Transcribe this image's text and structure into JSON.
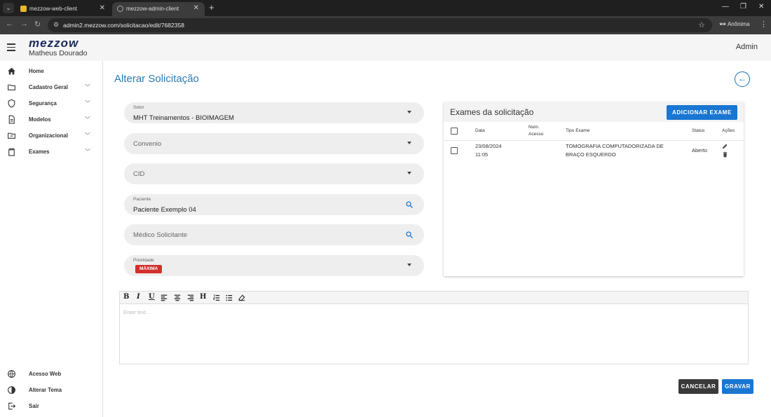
{
  "browser": {
    "tabs": [
      {
        "title": "mezzow-web-client"
      },
      {
        "title": "mezzow-admin-client"
      }
    ],
    "url": "admin2.mezzow.com/solicitacao/edit/7682358",
    "profile_label": "Anônima"
  },
  "header": {
    "logo": "mezzow",
    "user_name": "Matheus Dourado",
    "role": "Admin"
  },
  "sidebar": {
    "items": [
      {
        "label": "Home",
        "icon": "home-icon"
      },
      {
        "label": "Cadastro Geral",
        "icon": "folder-icon"
      },
      {
        "label": "Segurança",
        "icon": "shield-icon"
      },
      {
        "label": "Modelos",
        "icon": "document-icon"
      },
      {
        "label": "Organizacional",
        "icon": "folder-org-icon"
      },
      {
        "label": "Exames",
        "icon": "clipboard-icon"
      }
    ],
    "bottom_items": [
      {
        "label": "Acesso Web",
        "icon": "globe-icon"
      },
      {
        "label": "Alterar Tema",
        "icon": "contrast-icon"
      },
      {
        "label": "Sair",
        "icon": "logout-icon"
      }
    ]
  },
  "page": {
    "title": "Alterar Solicitação"
  },
  "form": {
    "setor": {
      "label": "Setor",
      "value": "MHT Treinamentos - BIOIMAGEM"
    },
    "convenio": {
      "placeholder": "Convenio"
    },
    "cid": {
      "placeholder": "CID"
    },
    "paciente": {
      "label": "Paciente",
      "value": "Paciente Exemplo 04"
    },
    "medico": {
      "placeholder": "Médico Solicitante"
    },
    "prioridade": {
      "label": "Prioridade",
      "value": "MÁXIMA",
      "color": "#d32f2f"
    }
  },
  "exams": {
    "title": "Exames da solicitação",
    "add_label": "ADICIONAR EXAME",
    "columns": {
      "data": "Data",
      "num_acesso_1": "Num.",
      "num_acesso_2": "Acesso",
      "tipo": "Tipo Exame",
      "status": "Status",
      "acoes": "Ações"
    },
    "rows": [
      {
        "date": "23/08/2024",
        "time": "11:05",
        "num_acesso": "",
        "tipo_1": "TOMOGRAFIA COMPUTADORIZADA DE",
        "tipo_2": "BRAÇO ESQUERDO",
        "status": "Aberto"
      }
    ]
  },
  "editor": {
    "placeholder": "Enter text..."
  },
  "actions": {
    "cancel": "CANCELAR",
    "save": "GRAVAR"
  },
  "colors": {
    "primary": "#1976d2",
    "title": "#2a7bb5",
    "danger": "#d32f2f"
  }
}
